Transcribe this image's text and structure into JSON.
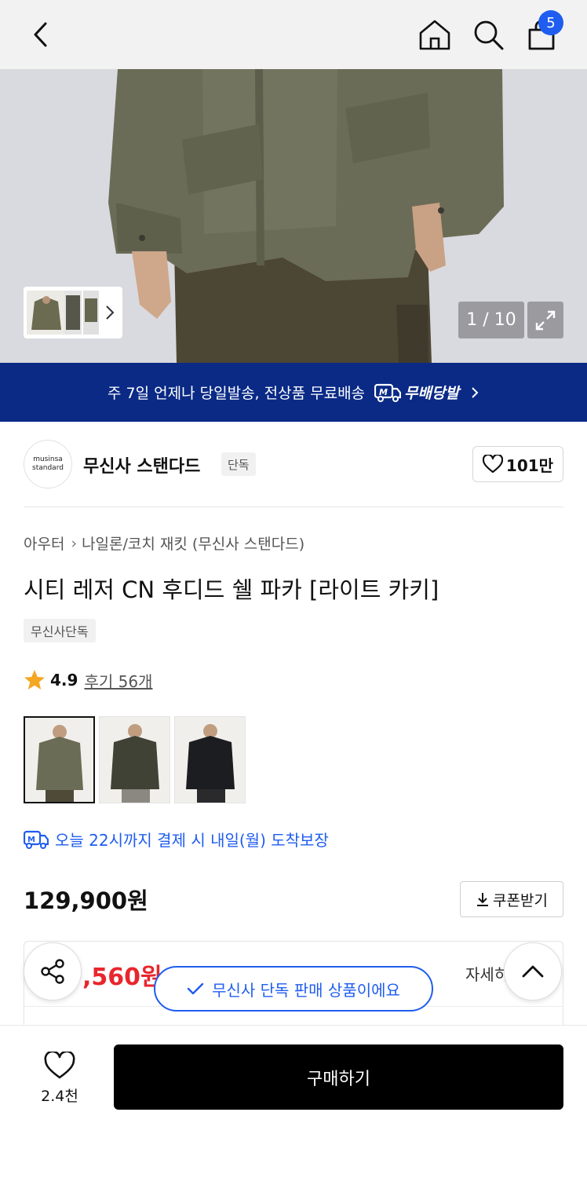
{
  "header": {
    "back_icon": "chevron-left-icon",
    "home_icon": "home-icon",
    "search_icon": "search-icon",
    "bag_icon": "shopping-bag-icon",
    "bag_count": "5"
  },
  "gallery": {
    "counter": "1 / 10",
    "expand_icon": "expand-icon"
  },
  "delivery_banner": {
    "text": "주 7일 언제나 당일발송, 전상품 무료배송",
    "brand_label": "무배당발"
  },
  "brand": {
    "logo_line1": "musinsa",
    "logo_line2": "standard",
    "name": "무신사 스탠다드",
    "tag": "단독",
    "likes": "101만"
  },
  "breadcrumb": {
    "items": [
      "아우터",
      "나일론/코치 재킷 (무신사 스탠다드)"
    ]
  },
  "product": {
    "title": "시티 레저 CN 후디드 쉘 파카 [라이트 카키]",
    "exclusive_tag": "무신사단독",
    "rating": "4.9",
    "reviews": "후기 56개",
    "arrival": "오늘 22시까지 결제 시 내일(월) 도착보장",
    "price": "129,900원",
    "coupon_label": "쿠폰받기",
    "benefit_price": ",560원",
    "detail_label": "자세히"
  },
  "toast": {
    "text": "무신사 단독 판매 상품이에요"
  },
  "bottom_bar": {
    "wish_count": "2.4천",
    "buy_label": "구매하기"
  },
  "colors": {
    "accent_blue": "#1f5df0",
    "banner_navy": "#0a2a86",
    "price_red": "#e8262d"
  }
}
